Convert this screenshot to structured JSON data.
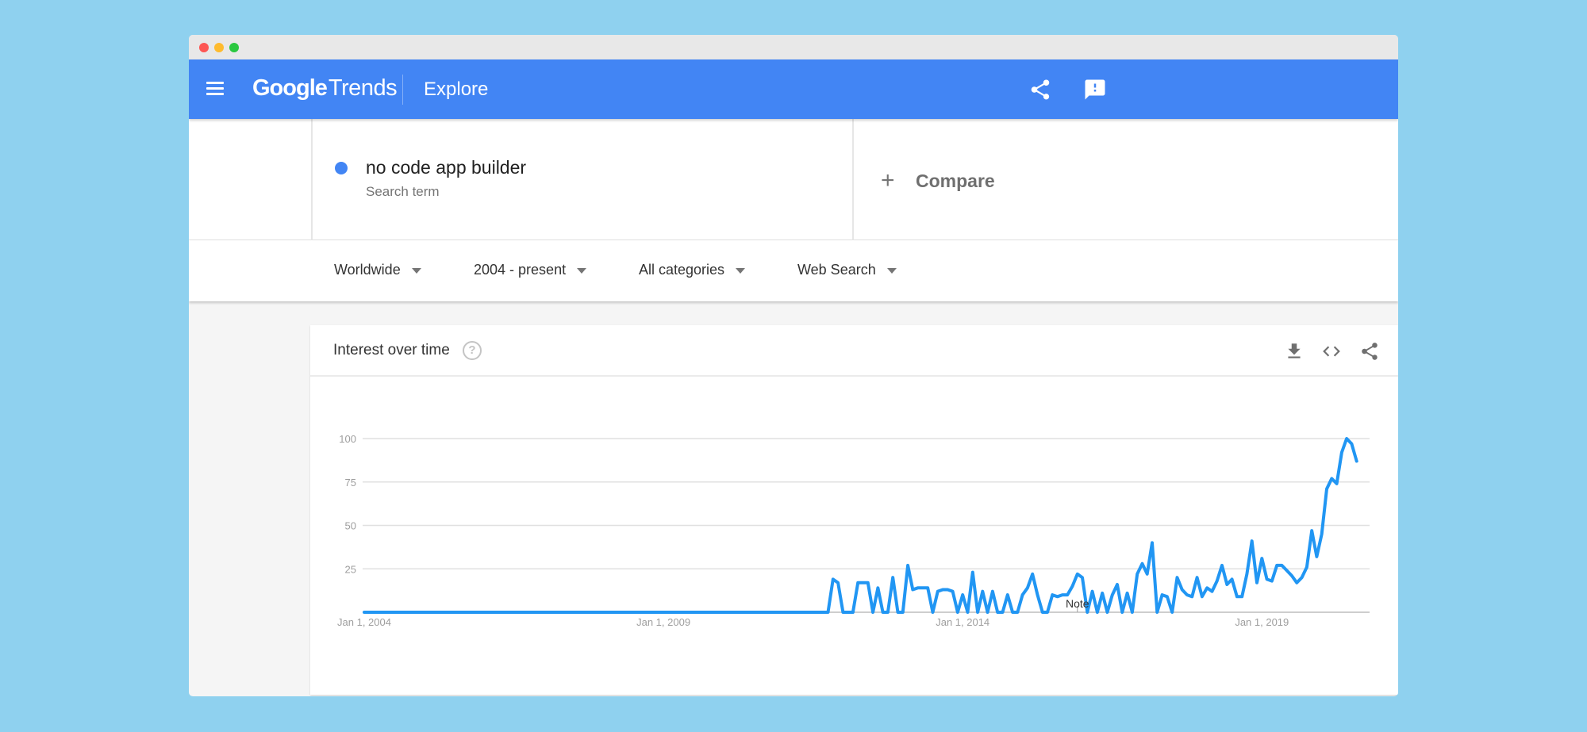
{
  "window": {
    "traffic_lights": [
      "close",
      "minimize",
      "maximize"
    ]
  },
  "header": {
    "logo_google": "Google",
    "logo_trends": "Trends",
    "page": "Explore",
    "icons": [
      "menu-icon",
      "share-icon",
      "feedback-icon"
    ],
    "brand_color": "#4285f4"
  },
  "search": {
    "term": "no code app builder",
    "term_sub": "Search term",
    "term_color": "#4285f4",
    "compare_symbol": "+",
    "compare_label": "Compare"
  },
  "filters": [
    {
      "label": "Worldwide"
    },
    {
      "label": "2004 - present"
    },
    {
      "label": "All categories"
    },
    {
      "label": "Web Search"
    }
  ],
  "card": {
    "title": "Interest over time",
    "help_symbol": "?",
    "actions": [
      "download-icon",
      "embed-icon",
      "share-icon"
    ]
  },
  "chart_data": {
    "type": "line",
    "title": "Interest over time",
    "xlabel": "",
    "ylabel": "",
    "ylim": [
      0,
      100
    ],
    "yticks": [
      100,
      75,
      50,
      25
    ],
    "xticks": [
      {
        "label": "Jan 1, 2004",
        "month_index": 0
      },
      {
        "label": "Jan 1, 2009",
        "month_index": 60
      },
      {
        "label": "Jan 1, 2014",
        "month_index": 120
      },
      {
        "label": "Jan 1, 2019",
        "month_index": 180
      }
    ],
    "x_start": "Jan 2004",
    "x_unit": "month",
    "annotation": {
      "label": "Note",
      "month_index": 143
    },
    "grid": true,
    "series": [
      {
        "name": "no code app builder",
        "color": "#2196f3",
        "leading_zero_months": 94,
        "values": [
          19,
          17,
          0,
          0,
          0,
          17,
          17,
          17,
          0,
          14,
          0,
          0,
          20,
          0,
          0,
          27,
          13,
          14,
          14,
          14,
          0,
          12,
          13,
          13,
          12,
          0,
          10,
          0,
          23,
          0,
          12,
          0,
          12,
          0,
          0,
          10,
          0,
          0,
          10,
          14,
          22,
          10,
          0,
          0,
          10,
          9,
          10,
          10,
          15,
          22,
          20,
          0,
          12,
          0,
          11,
          0,
          10,
          16,
          0,
          11,
          0,
          22,
          28,
          22,
          40,
          0,
          10,
          9,
          0,
          20,
          13,
          10,
          9,
          20,
          9,
          14,
          12,
          18,
          27,
          16,
          19,
          9,
          9,
          22,
          41,
          17,
          31,
          19,
          18,
          27,
          27,
          24,
          21,
          17,
          20,
          26,
          47,
          32,
          45,
          71,
          77,
          74,
          92,
          100,
          97,
          87
        ]
      }
    ]
  }
}
